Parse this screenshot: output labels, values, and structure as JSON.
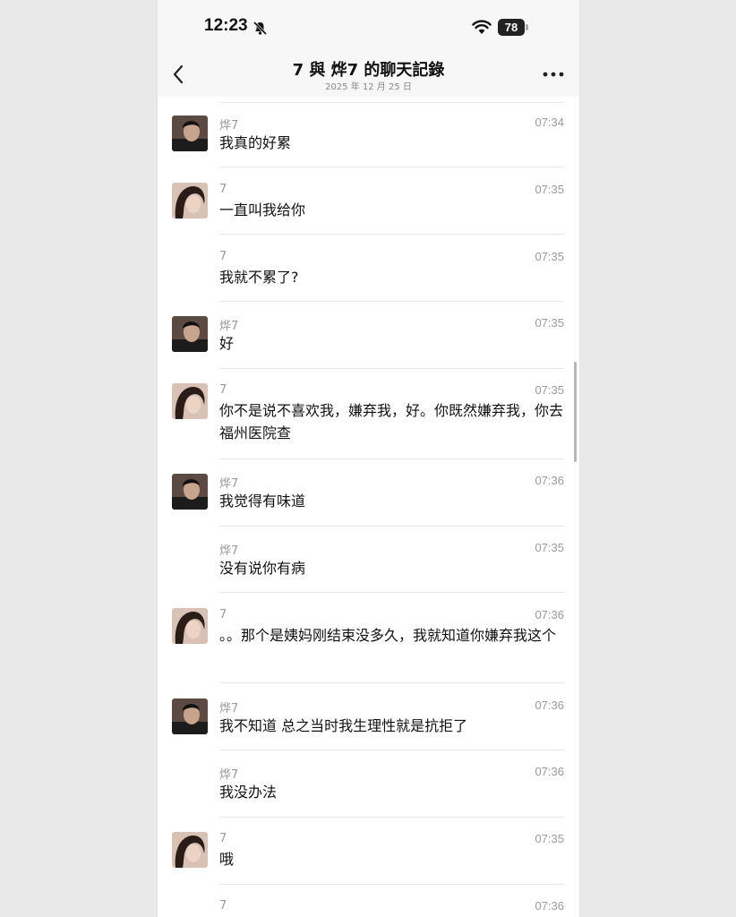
{
  "status_bar": {
    "time": "12:23",
    "battery": "78"
  },
  "header": {
    "title": "7 與 烨7 的聊天記錄",
    "subtitle": "2025 年 12 月 25 日"
  },
  "messages": [
    {
      "sender": "烨7",
      "time": "07:34",
      "text": "我真的好累",
      "avatar": "male"
    },
    {
      "sender": "7",
      "time": "07:35",
      "text": "一直叫我给你",
      "avatar": "female"
    },
    {
      "sender": "7",
      "time": "07:35",
      "text": "我就不累了?",
      "avatar": "none"
    },
    {
      "sender": "烨7",
      "time": "07:35",
      "text": "好",
      "avatar": "male"
    },
    {
      "sender": "7",
      "time": "07:35",
      "text": "你不是说不喜欢我，嫌弃我，好。你既然嫌弃我，你去福州医院查",
      "avatar": "female"
    },
    {
      "sender": "烨7",
      "time": "07:36",
      "text": "我觉得有味道",
      "avatar": "male"
    },
    {
      "sender": "烨7",
      "time": "07:35",
      "text": "没有说你有病",
      "avatar": "none"
    },
    {
      "sender": "7",
      "time": "07:36",
      "text": "。。那个是姨妈刚结束没多久，我就知道你嫌弃我这个",
      "avatar": "female"
    },
    {
      "sender": "烨7",
      "time": "07:36",
      "text": "我不知道 总之当时我生理性就是抗拒了",
      "avatar": "male"
    },
    {
      "sender": "烨7",
      "time": "07:36",
      "text": "我没办法",
      "avatar": "none"
    },
    {
      "sender": "7",
      "time": "07:35",
      "text": "哦",
      "avatar": "female"
    },
    {
      "sender": "7",
      "time": "07:36",
      "text": "",
      "avatar": "none"
    }
  ]
}
